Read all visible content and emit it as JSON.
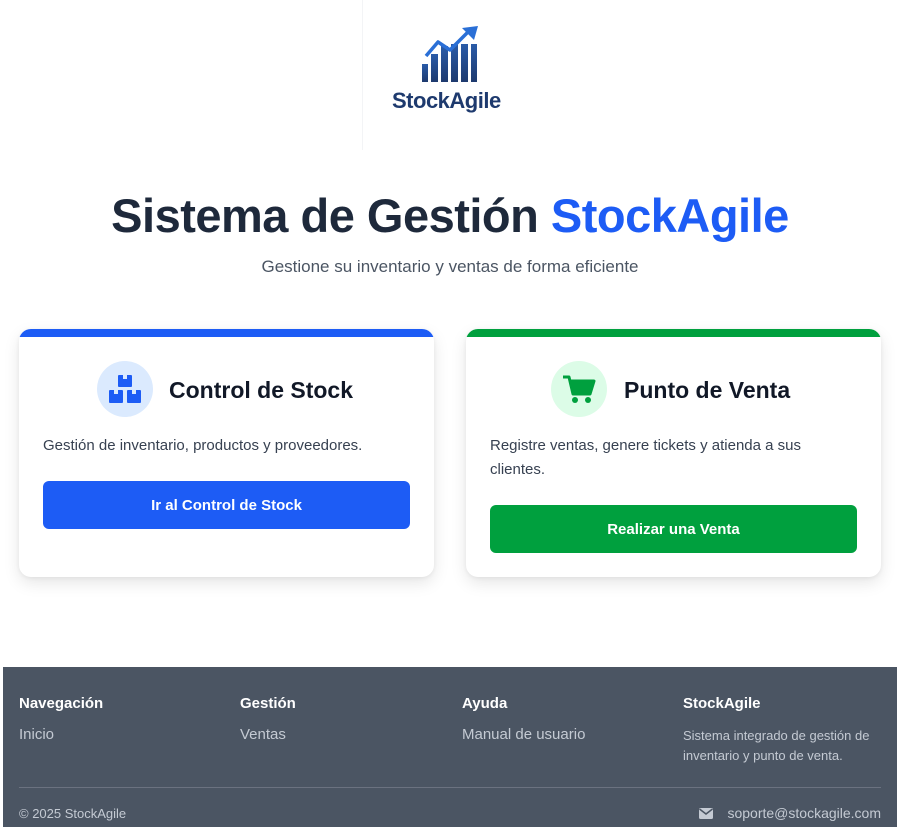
{
  "brand": {
    "name": "StockAgile",
    "colors": {
      "primary": "#1d5cf5",
      "success": "#00a03e",
      "dark": "#1e293b",
      "footer_bg": "#4b5563"
    }
  },
  "hero": {
    "title_main": "Sistema de Gestión",
    "title_accent": "StockAgile",
    "subtitle": "Gestione su inventario y ventas de forma eficiente"
  },
  "cards": {
    "stock": {
      "icon": "boxes-icon",
      "title": "Control de Stock",
      "description": "Gestión de inventario, productos y proveedores.",
      "button_label": "Ir al Control de Stock"
    },
    "venta": {
      "icon": "shopping-cart-icon",
      "title": "Punto de Venta",
      "description": "Registre ventas, genere tickets y atienda a sus clientes.",
      "button_label": "Realizar una Venta"
    }
  },
  "footer": {
    "navegacion": {
      "heading": "Navegación",
      "links": [
        "Inicio"
      ]
    },
    "gestion": {
      "heading": "Gestión",
      "links": [
        "Ventas"
      ]
    },
    "ayuda": {
      "heading": "Ayuda",
      "links": [
        "Manual de usuario"
      ]
    },
    "about": {
      "heading": "StockAgile",
      "text": "Sistema integrado de gestión de inventario y punto de venta."
    },
    "copyright": "© 2025 StockAgile",
    "contact_icon": "envelope-icon",
    "contact_email": "soporte@stockagile.com"
  }
}
